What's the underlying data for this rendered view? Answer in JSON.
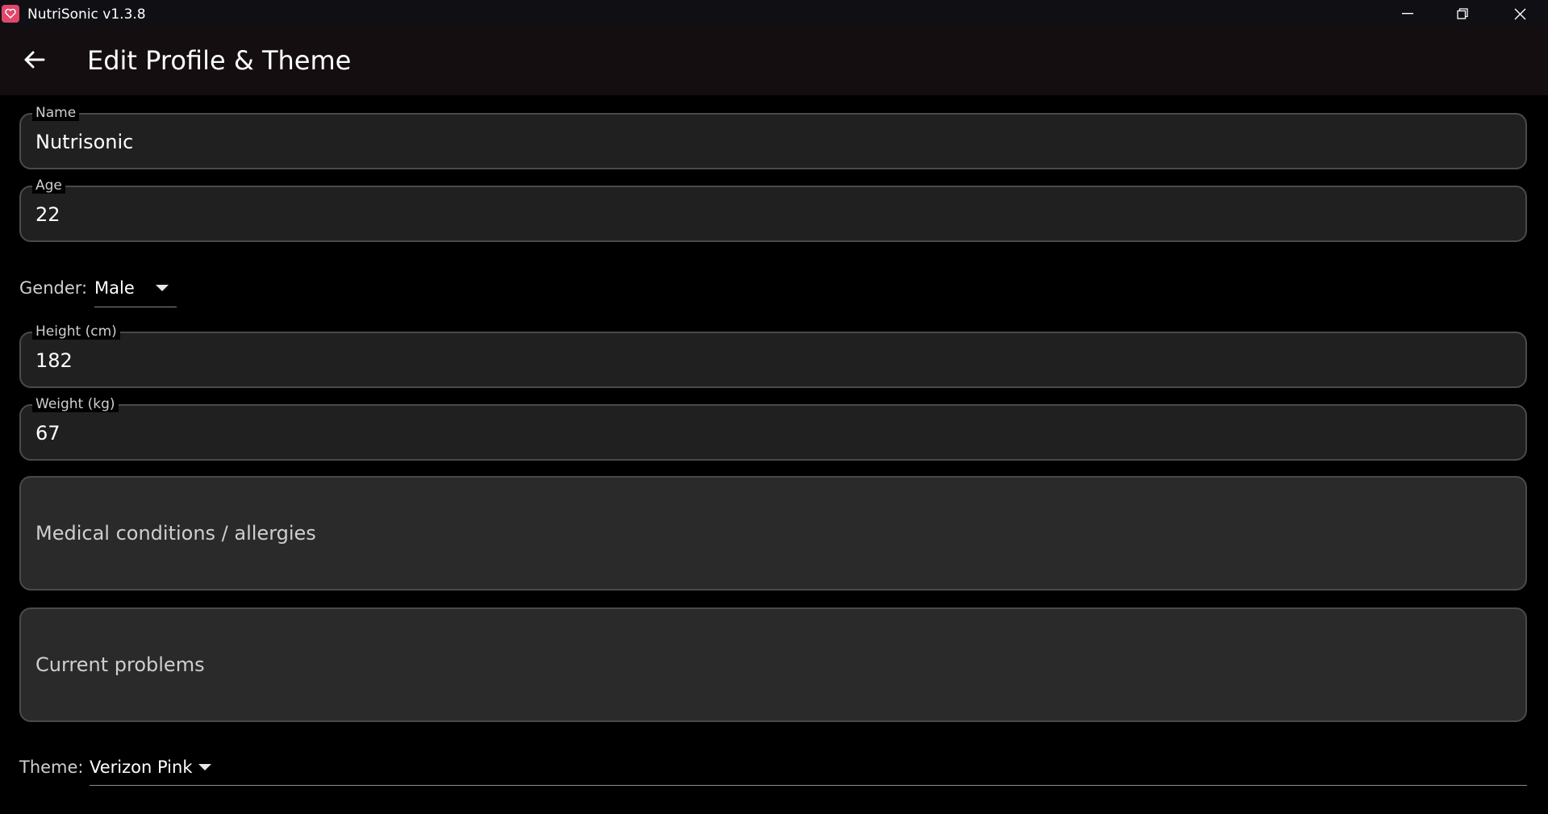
{
  "window": {
    "title": "NutriSonic v1.3.8",
    "controls": [
      "minimize-icon",
      "restore-icon",
      "close-icon"
    ]
  },
  "appbar": {
    "title": "Edit Profile & Theme",
    "back_icon": "arrow-left-icon"
  },
  "form": {
    "name": {
      "label": "Name",
      "value": "Nutrisonic"
    },
    "age": {
      "label": "Age",
      "value": "22"
    },
    "gender": {
      "label": "Gender:",
      "value": "Male"
    },
    "height": {
      "label": "Height (cm)",
      "value": "182"
    },
    "weight": {
      "label": "Weight (kg)",
      "value": "67"
    },
    "medical": {
      "placeholder": "Medical conditions / allergies"
    },
    "problems": {
      "placeholder": "Current problems"
    },
    "theme": {
      "label": "Theme:",
      "value": "Verizon Pink"
    }
  },
  "colors": {
    "background": "#000000",
    "field_fill": "#202020",
    "field_border": "#4a4a4a",
    "accent": "#e0486b"
  }
}
